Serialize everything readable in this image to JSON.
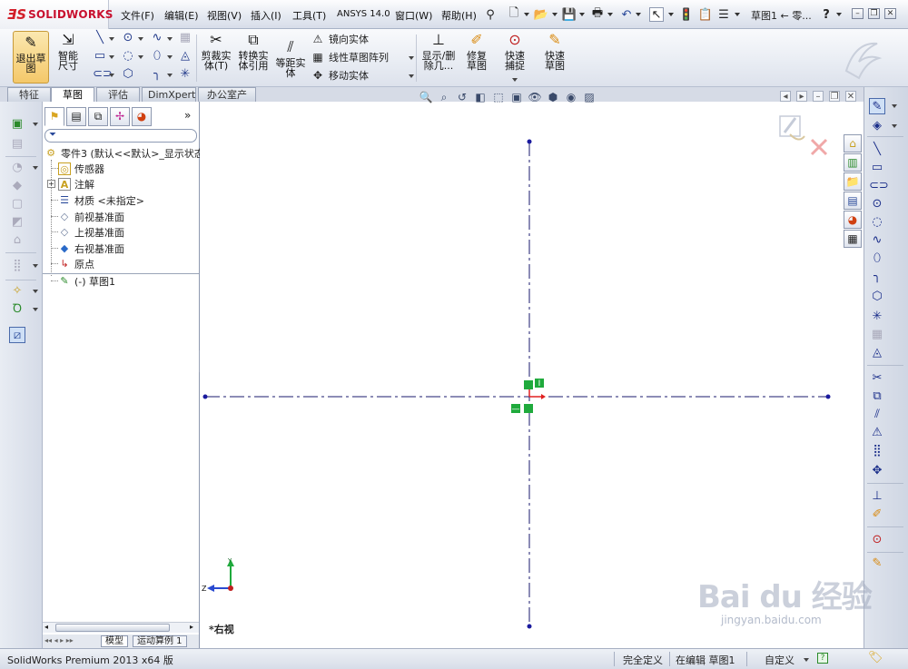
{
  "app": {
    "logo_glyph": "ƎS",
    "brand": "SOLIDWORKS",
    "title": "草图1 ← 零...",
    "help": "?"
  },
  "menu": [
    "文件(F)",
    "编辑(E)",
    "视图(V)",
    "插入(I)",
    "工具(T)",
    "ANSYS 14.0",
    "窗口(W)",
    "帮助(H)"
  ],
  "commands": {
    "exit_sketch": "退出草图",
    "smart_dim": "智能尺寸",
    "trim": "剪裁实体(T)",
    "convert": "转换实体引用",
    "offset": "等距实体",
    "mirror": "镜向实体",
    "linear_pattern": "线性草图阵列",
    "move": "移动实体",
    "show_delete": "显示/删除几...",
    "repair": "修复草图",
    "quick_snaps": "快速捕捉",
    "rapid_sketch": "快速草图"
  },
  "tabs": [
    "特征",
    "草图",
    "评估",
    "DimXpert",
    "办公室产品"
  ],
  "active_tab": 1,
  "tree": {
    "root": "零件3 (默认<<默认>_显示状态",
    "items": [
      "传感器",
      "注解",
      "材质 <未指定>",
      "前视基准面",
      "上视基准面",
      "右视基准面",
      "原点",
      "(-) 草图1"
    ]
  },
  "bottom_tabs": [
    "模型",
    "运动算例 1"
  ],
  "view_label": "*右视",
  "triad": {
    "y": "Y",
    "z": "Z"
  },
  "relations": {
    "top": "I",
    "left": "—"
  },
  "status": {
    "product": "SolidWorks Premium 2013 x64 版",
    "definition": "完全定义",
    "editing": "在编辑 草图1",
    "units": "自定义"
  },
  "watermark": {
    "text": "Bai du 经验",
    "url": "jingyan.baidu.com"
  },
  "colors": {
    "brand": "#c8102e",
    "axis": "#1a1a6e",
    "relation": "#1faa3c",
    "arrow": "#e02020"
  }
}
